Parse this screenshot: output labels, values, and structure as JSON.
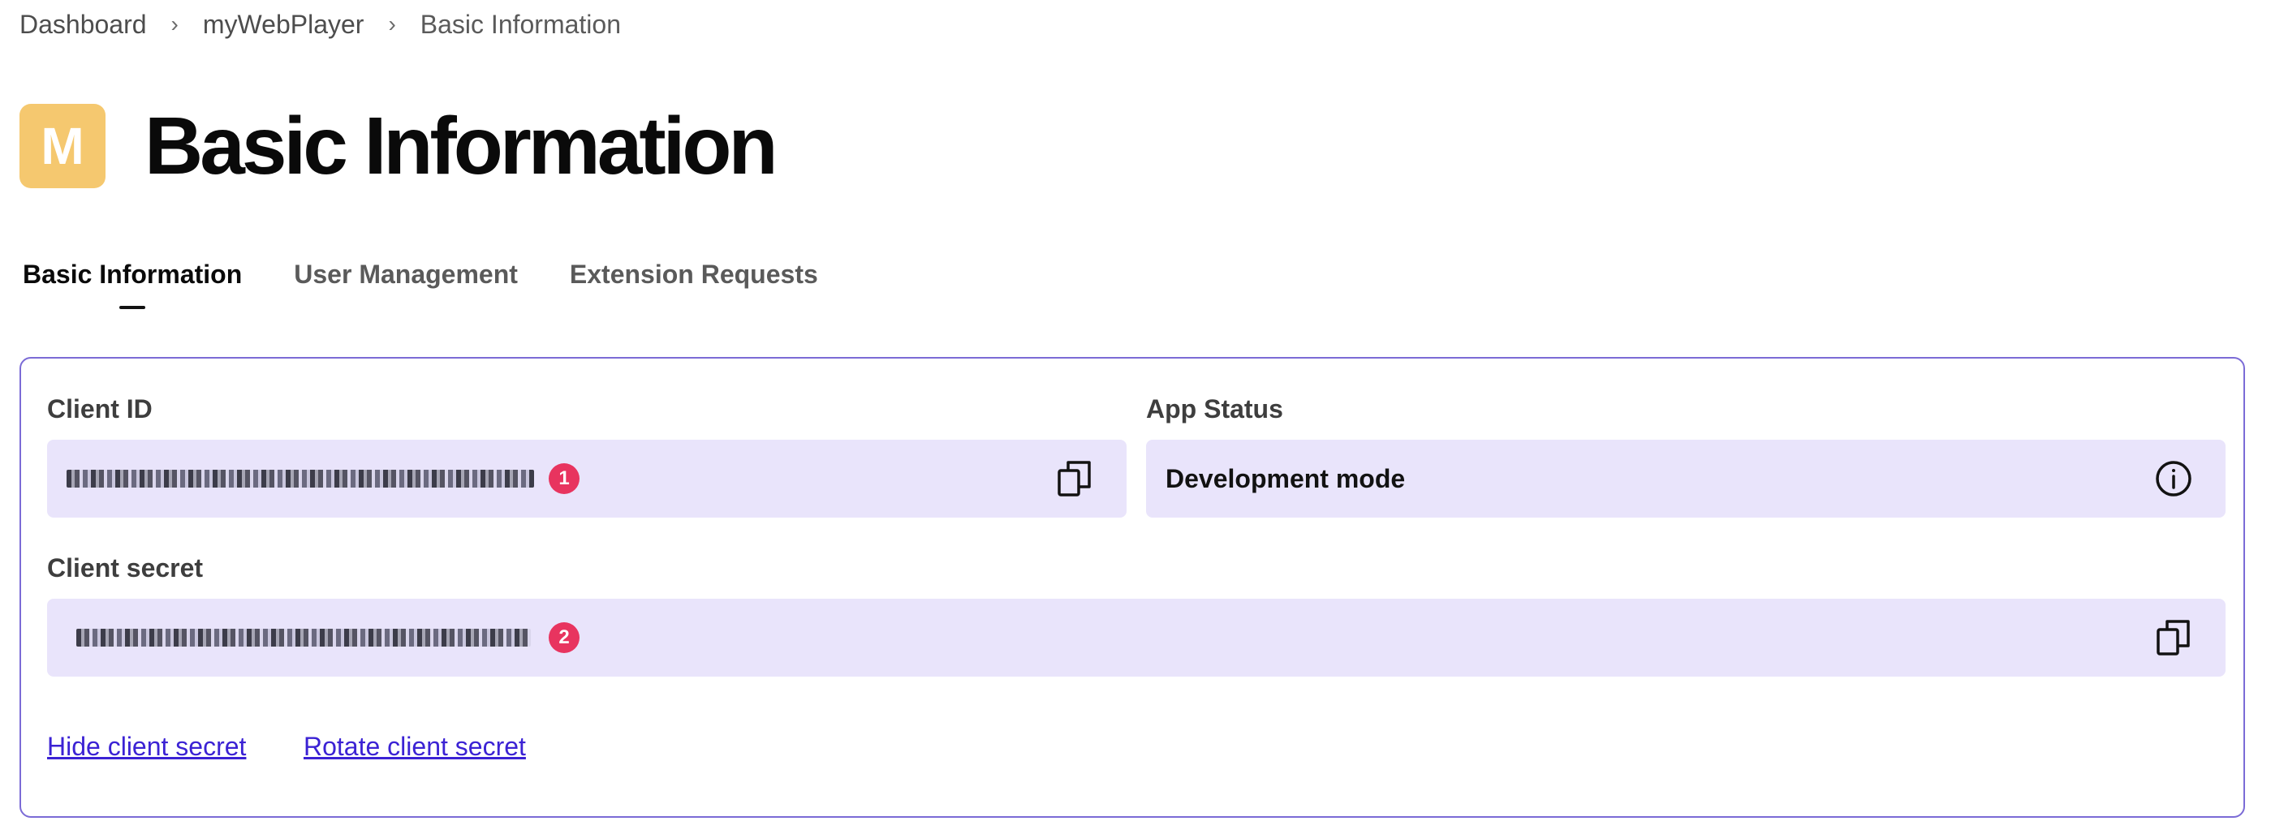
{
  "breadcrumb": {
    "items": [
      "Dashboard",
      "myWebPlayer",
      "Basic Information"
    ],
    "separator": "›"
  },
  "header": {
    "avatar_letter": "M",
    "avatar_color": "#f5c86f",
    "title": "Basic Information"
  },
  "tabs": [
    {
      "label": "Basic Information",
      "active": true
    },
    {
      "label": "User Management",
      "active": false
    },
    {
      "label": "Extension Requests",
      "active": false
    }
  ],
  "card": {
    "border_color": "#7b6bd6",
    "client_id": {
      "label": "Client ID",
      "value_state": "masked",
      "badge": "1",
      "copy_icon": "copy-icon"
    },
    "app_status": {
      "label": "App Status",
      "value": "Development mode",
      "info_icon": "info-icon"
    },
    "client_secret": {
      "label": "Client secret",
      "value_state": "masked",
      "badge": "2",
      "copy_icon": "copy-icon"
    },
    "links": {
      "hide_secret": "Hide client secret",
      "rotate_secret": "Rotate client secret"
    }
  },
  "colors": {
    "field_bg": "#e9e4fb",
    "badge": "#e8345f",
    "link": "#3b22d4"
  }
}
